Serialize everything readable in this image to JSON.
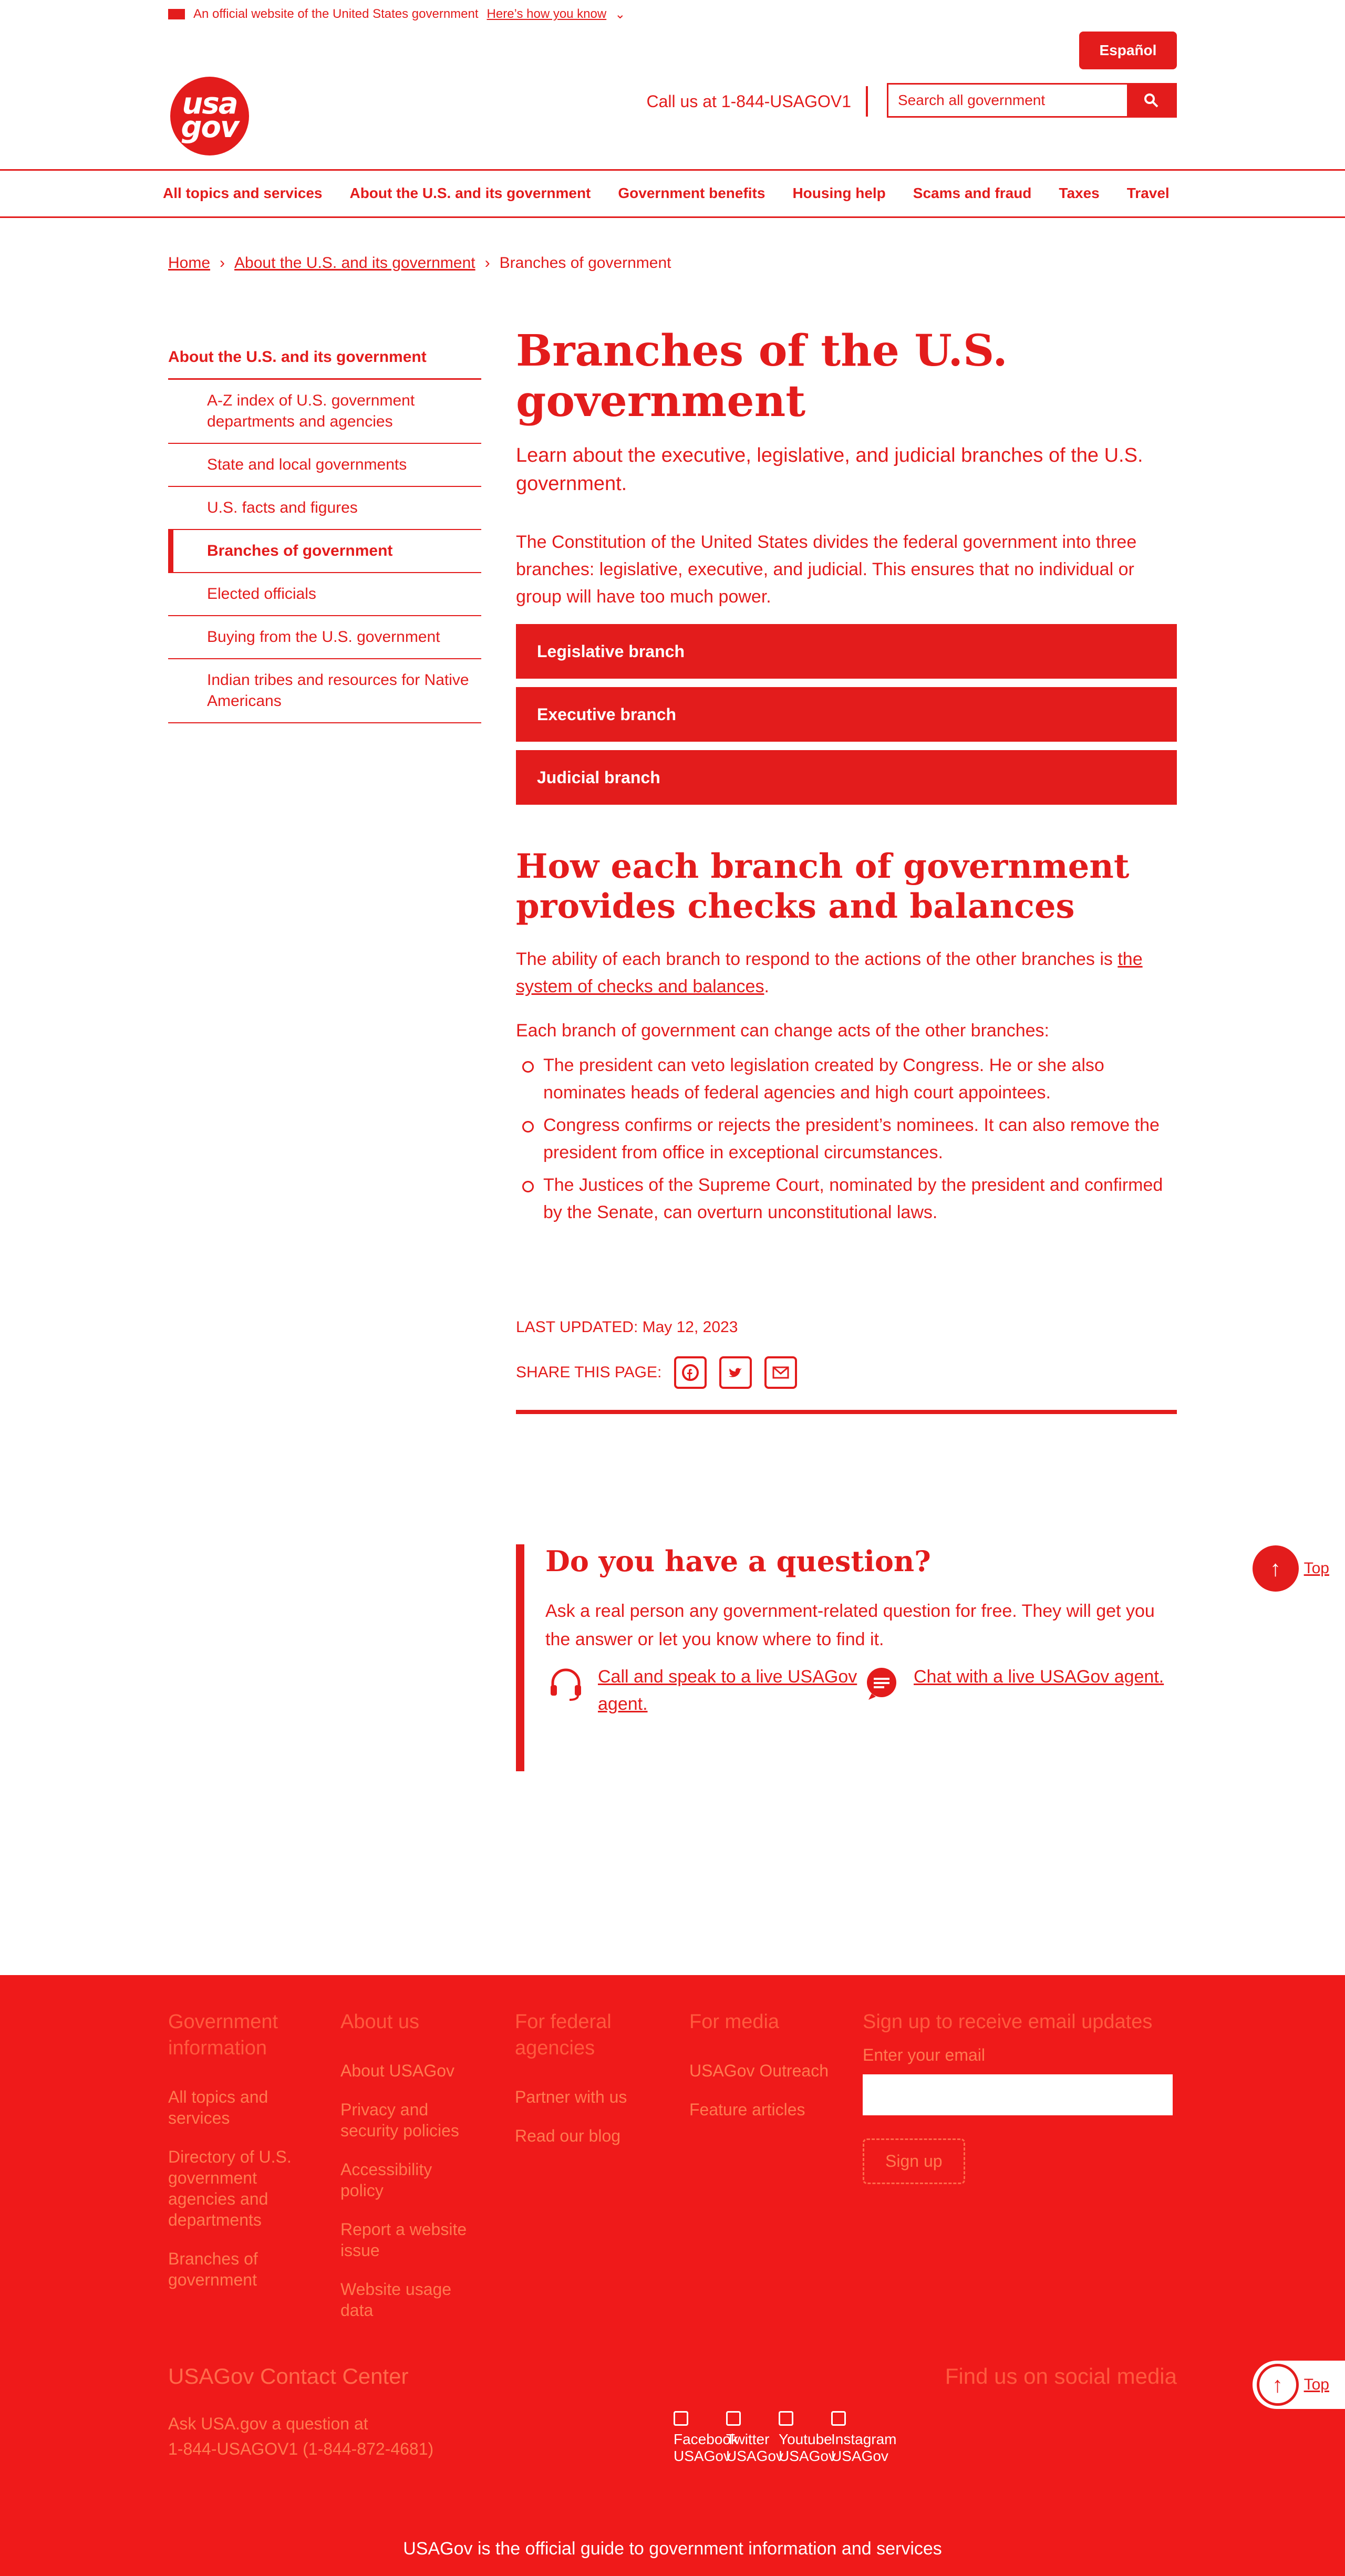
{
  "banner": {
    "text": "An official website of the United States government",
    "link": "Here’s how you know"
  },
  "header": {
    "logo_line1": "usa",
    "logo_line2": "gov",
    "espanol": "Español",
    "phone": "Call us at 1-844-USAGOV1",
    "search_placeholder": "Search all government",
    "search_icon": "magnifier-icon"
  },
  "nav": [
    "All topics and services",
    "About the U.S. and its government",
    "Government benefits",
    "Housing help",
    "Scams and fraud",
    "Taxes",
    "Travel"
  ],
  "breadcrumb": [
    "Home",
    "About the U.S. and its government",
    "Branches of government"
  ],
  "sidebar": {
    "heading": "About the U.S. and its government",
    "items": [
      "A-Z index of U.S. government departments and agencies",
      "State and local governments",
      "U.S. facts and figures",
      "Branches of government",
      "Elected officials",
      "Buying from the U.S. government",
      "Indian tribes and resources for Native Americans"
    ]
  },
  "main": {
    "title": "Branches of the U.S. government",
    "lede": "Learn about the executive, legislative, and judicial branches of the U.S. government.",
    "intro": "The Constitution of the United States divides the federal government into three branches: legislative, executive, and judicial. This ensures that no individual or group will have too much power.",
    "accordion": [
      "Legislative branch",
      "Executive branch",
      "Judicial branch"
    ],
    "checks_title": "How each branch of government provides checks and balances",
    "checks_p1_before": "The ability of each branch to respond to the actions of the other branches is ",
    "checks_p1_link": "the system of checks and balances",
    "checks_p1_after": ".",
    "checks_p2": "Each branch of government can change acts of the other branches:",
    "checks_items": [
      "The president can veto legislation created by Congress. He or she also nominates heads of federal agencies and high court appointees.",
      "Congress confirms or rejects the president’s nominees. It can also remove the president from office in exceptional circumstances.",
      "The Justices of the Supreme Court, nominated by the president and confirmed by the Senate, can overturn unconstitutional laws."
    ],
    "last_updated": "LAST UPDATED: May 12, 2023",
    "share_label": "SHARE THIS PAGE:"
  },
  "question": {
    "title": "Do you have a question?",
    "text": "Ask a real person any government-related question for free. They will get you the answer or let you know where to find it.",
    "call": "Call and speak to a live USAGov agent.",
    "chat": "Chat with a live USAGov agent."
  },
  "top_label": "Top",
  "footer": {
    "columns": [
      {
        "head": "Government information",
        "links": [
          "All topics and services",
          "Directory of U.S. government agencies and departments",
          "Branches of government"
        ]
      },
      {
        "head": "About us",
        "links": [
          "About USAGov",
          "Privacy and security policies",
          "Accessibility policy",
          "Report a website issue",
          "Website usage data"
        ]
      },
      {
        "head": "For federal agencies",
        "links": [
          "Partner with us",
          "Read our blog"
        ]
      },
      {
        "head": "For media",
        "links": [
          "USAGov Outreach",
          "Feature articles"
        ]
      }
    ],
    "email_head": "Sign up to receive email updates",
    "email_label": "Enter your email",
    "signup": "Sign up",
    "contact_title": "USAGov Contact Center",
    "contact_line1": "Ask USA.gov a question at",
    "contact_line2": "1-844-USAGOV1 (1-844-872-4681)",
    "social_title": "Find us on social media",
    "social": [
      "Facebook USAGov",
      "Twitter USAGov",
      "Youtube USAGov",
      "Instagram USAGov"
    ],
    "bottom": "USAGov is the official guide to government information and services"
  },
  "colors": {
    "accent": "#e31c1c",
    "footer_bg": "#ef1a1a"
  }
}
